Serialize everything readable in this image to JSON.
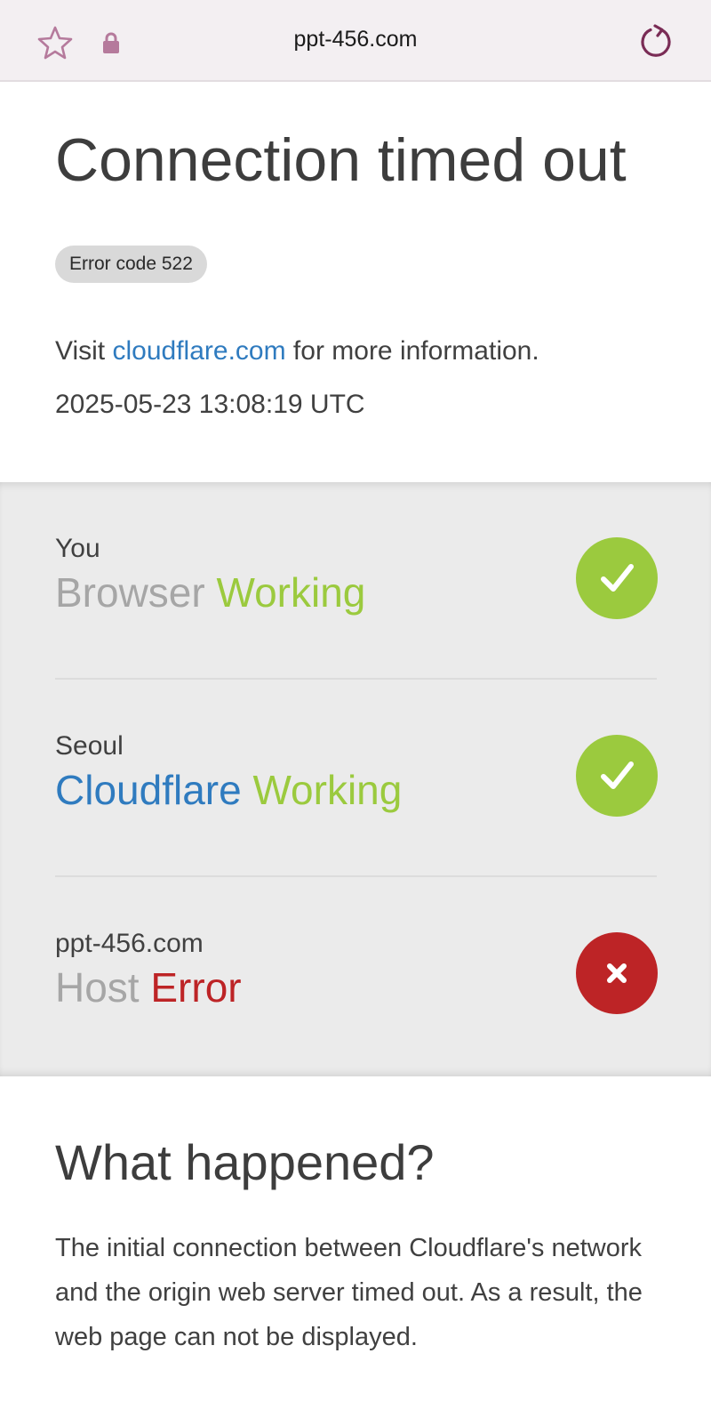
{
  "browser": {
    "url": "ppt-456.com",
    "icons": {
      "favorite": "star-icon",
      "security": "lock-icon",
      "reload": "reload-icon"
    }
  },
  "error": {
    "title": "Connection timed out",
    "code_label": "Error code 522",
    "visit_prefix": "Visit",
    "visit_link": "cloudflare.com",
    "visit_suffix": "for more information.",
    "timestamp": "2025-05-23 13:08:19 UTC"
  },
  "status_rows": [
    {
      "location": "You",
      "name": "Browser",
      "status": "Working",
      "ok": true,
      "icon": "check-icon"
    },
    {
      "location": "Seoul",
      "name": "Cloudflare",
      "status": "Working",
      "ok": true,
      "icon": "check-icon"
    },
    {
      "location": "ppt-456.com",
      "name": "Host",
      "status": "Error",
      "ok": false,
      "icon": "close-icon"
    }
  ],
  "what_happened": {
    "heading": "What happened?",
    "body": "The initial connection between Cloudflare's network and the origin web server timed out. As a result, the web page can not be displayed."
  },
  "colors": {
    "working": "#9bca3e",
    "error": "#bd2426",
    "link": "#2f7bbf",
    "status_bg": "#ebebeb",
    "topbar_bg": "#f3eff2",
    "topbar_icon": "#b57a9c",
    "reload_icon": "#7a2c56"
  }
}
